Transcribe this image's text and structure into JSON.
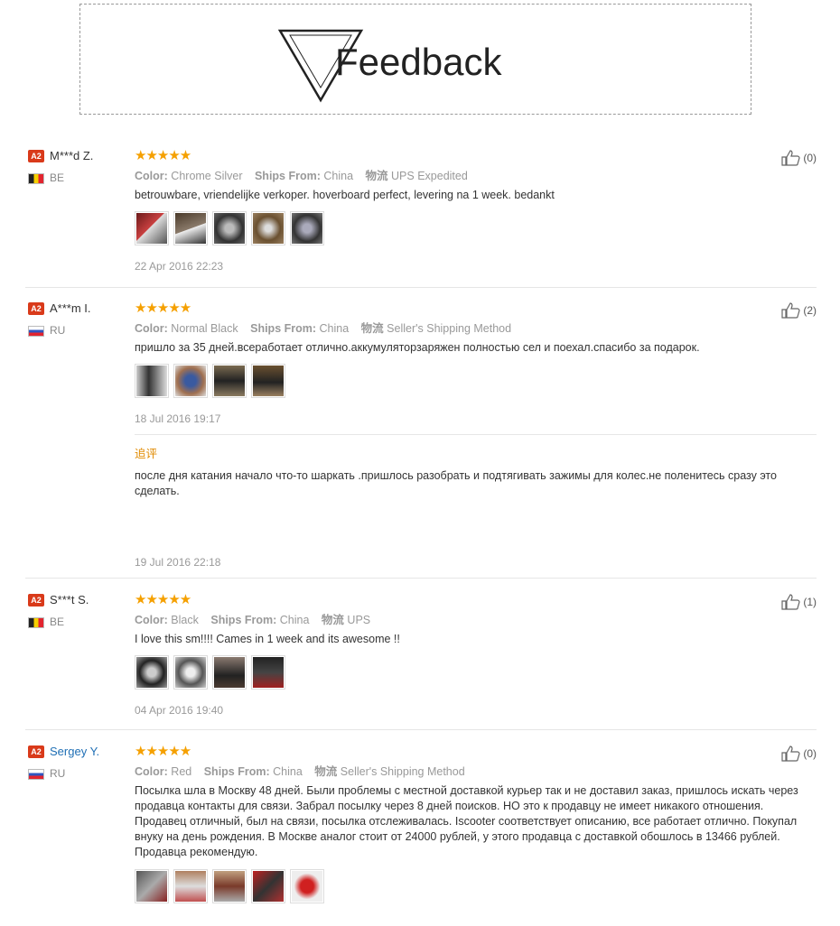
{
  "banner": {
    "title": "Feedback"
  },
  "reviews": [
    {
      "badge": "A2",
      "name": "M***d Z.",
      "country": "BE",
      "color_label": "Color:",
      "color": "Chrome Silver",
      "ships_label": "Ships From:",
      "ships": "China",
      "logistics_label": "物流",
      "logistics": "UPS Expedited",
      "text": "betrouwbare, vriendelijke verkoper. hoverboard perfect, levering na 1 week. bedankt",
      "date": "22 Apr 2016 22:23",
      "helpful": "(0)"
    },
    {
      "badge": "A2",
      "name": "A***m I.",
      "country": "RU",
      "color_label": "Color:",
      "color": "Normal Black",
      "ships_label": "Ships From:",
      "ships": "China",
      "logistics_label": "物流",
      "logistics": "Seller's Shipping Method",
      "text": "пришло за 35 дней.всеработает отлично.аккумуляторзаряжен полностью сел и поехал.спасибо за подарок.",
      "date": "18 Jul 2016 19:17",
      "helpful": "(2)",
      "followup_label": "追评",
      "followup_text": "после дня катания начало что-то шаркать .пришлось разобрать и подтягивать зажимы для колес.не поленитесь сразу это сделать.",
      "followup_date": "19 Jul 2016 22:18"
    },
    {
      "badge": "A2",
      "name": "S***t S.",
      "country": "BE",
      "color_label": "Color:",
      "color": "Black",
      "ships_label": "Ships From:",
      "ships": "China",
      "logistics_label": "物流",
      "logistics": "UPS",
      "text": "I love this sm!!!! Cames in 1 week and its awesome !!",
      "date": "04 Apr 2016 19:40",
      "helpful": "(1)"
    },
    {
      "badge": "A2",
      "name": "Sergey Y.",
      "country": "RU",
      "color_label": "Color:",
      "color": "Red",
      "ships_label": "Ships From:",
      "ships": "China",
      "logistics_label": "物流",
      "logistics": "Seller's Shipping Method",
      "text": "Посылка шла в Москву 48 дней. Были проблемы с местной доставкой курьер так и не доставил заказ, пришлось искать через продавца контакты для связи. Забрал посылку через 8 дней поисков. НО это к продавцу не имеет никакого отношения. Продавец отличный, был на связи, посылка отслеживалась. Iscooter соответствует описанию, все работает отлично. Покупал внуку на день рождения. В Москве аналог стоит от 24000 рублей, у этого продавца с доставкой обошлось в 13466 рублей. Продавца рекомендую.",
      "helpful": "(0)"
    }
  ],
  "stars": "★★★★★",
  "colors": {
    "star": "#f5a000",
    "badge": "#d93a1a",
    "followup": "#e08a00",
    "link": "#1f6fb5"
  },
  "icons": {
    "thumb": "thumbs-up-icon"
  }
}
